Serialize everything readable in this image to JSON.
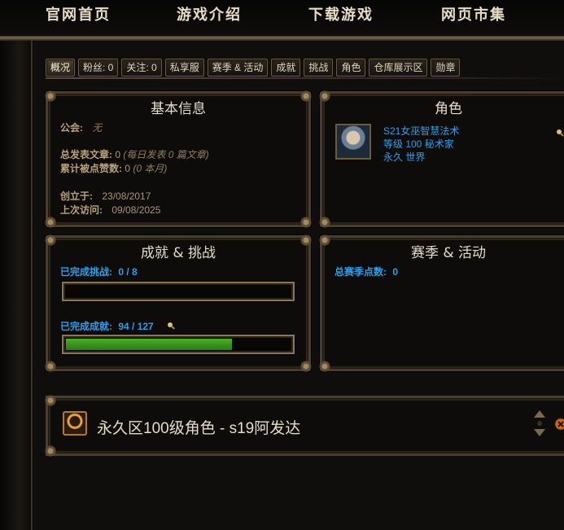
{
  "nav": {
    "items": [
      "官网首页",
      "游戏介绍",
      "下载游戏",
      "网页市集"
    ]
  },
  "tabs": [
    "概况",
    "粉丝: 0",
    "关注: 0",
    "私享服",
    "赛季 & 活动",
    "成就",
    "挑战",
    "角色",
    "仓库展示区",
    "勋章"
  ],
  "basic_info": {
    "title": "基本信息",
    "guild_label": "公会:",
    "guild_value": "无",
    "posts_label": "总发表文章:",
    "posts_value": "0",
    "posts_note": "(每日发表 0 篇文章)",
    "likes_label": "累计被点赞数:",
    "likes_value": "0",
    "likes_note": "(0 本月)",
    "created_label": "创立于:",
    "created_value": "23/08/2017",
    "visit_label": "上次访问:",
    "visit_value": "09/08/2025"
  },
  "character": {
    "title": "角色",
    "name": "S21女巫智慧法术",
    "level_class": "等级 100 秘术家",
    "realm": "永久 世界"
  },
  "achievements": {
    "title": "成就 & 挑战",
    "challenges_label": "已完成挑战:",
    "challenges_value": "0 / 8",
    "challenges_progress": 0,
    "achievements_label": "已完成成就:",
    "achievements_value": "94 / 127",
    "achievements_progress": 0.74
  },
  "season": {
    "title": "赛季 & 活动",
    "points_label": "总赛季点数:",
    "points_value": "0"
  },
  "bottom": {
    "title": "永久区100级角色 - s19阿发达"
  },
  "colors": {
    "gold_text": "#c8b48a",
    "link_blue": "#2f9ee8",
    "progress_green": "#4cae2a",
    "frame_gold": "#8a7653"
  }
}
